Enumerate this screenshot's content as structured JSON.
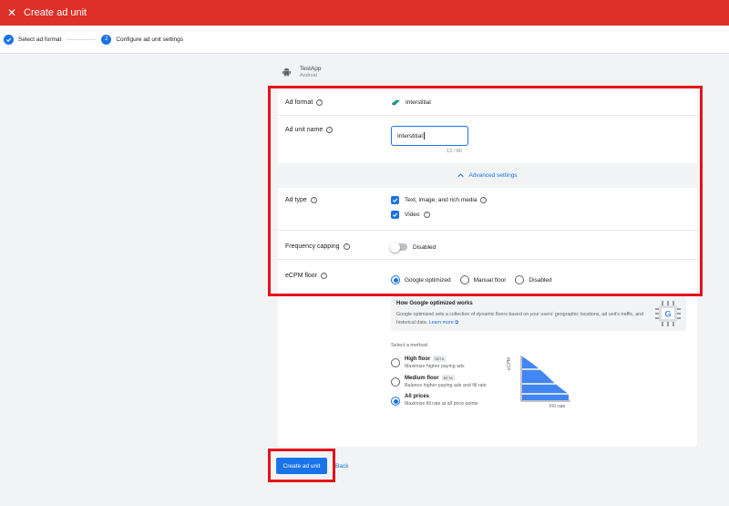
{
  "header": {
    "title": "Create ad unit",
    "close_icon": "close-icon"
  },
  "stepper": {
    "steps": [
      {
        "label": "Select ad format",
        "state": "done"
      },
      {
        "label": "Configure ad unit settings",
        "number": "2",
        "state": "active"
      }
    ]
  },
  "app": {
    "name": "TestApp",
    "platform": "Android"
  },
  "form": {
    "ad_format": {
      "label": "Ad format",
      "value": "Interstitial"
    },
    "ad_unit_name": {
      "label": "Ad unit name",
      "value": "Interstitial",
      "counter": "12 / 80"
    },
    "advanced_settings": {
      "label": "Advanced settings"
    },
    "ad_type": {
      "label": "Ad type",
      "options": [
        {
          "label": "Text, image, and rich media",
          "checked": true
        },
        {
          "label": "Video",
          "checked": true
        }
      ]
    },
    "frequency_capping": {
      "label": "Frequency capping",
      "state_label": "Disabled",
      "enabled": false
    },
    "ecpm_floor": {
      "label": "eCPM floor",
      "options": [
        {
          "label": "Google optimized",
          "selected": true
        },
        {
          "label": "Manual floor",
          "selected": false
        },
        {
          "label": "Disabled",
          "selected": false
        }
      ]
    }
  },
  "info": {
    "title": "How Google optimized works",
    "text": "Google optimized sets a collection of dynamic floors based on your users' geographic locations, ad unit's traffic, and historical data.",
    "link": "Learn more"
  },
  "method": {
    "label": "Select a method:",
    "options": [
      {
        "title": "High floor",
        "badge": "BETA",
        "desc": "Maximize higher paying ads",
        "selected": false
      },
      {
        "title": "Medium floor",
        "badge": "BETA",
        "desc": "Balance higher paying ads and fill rate",
        "selected": false
      },
      {
        "title": "All prices",
        "desc": "Maximize fill rate at all price points",
        "selected": true
      }
    ],
    "chart": {
      "ylabel": "eCPM",
      "xlabel": "Fill rate"
    }
  },
  "actions": {
    "create": "Create ad unit",
    "back": "Back"
  },
  "colors": {
    "header_red": "#dc3028",
    "primary_blue": "#1a73e8",
    "highlight_red": "#e5111a"
  }
}
